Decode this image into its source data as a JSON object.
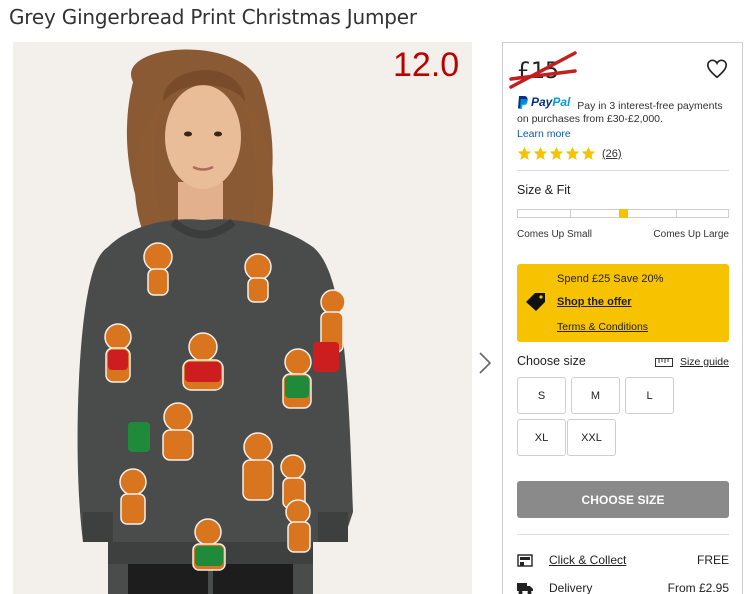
{
  "product": {
    "title": "Grey Gingerbread Print Christmas Jumper",
    "image_overlay_price": "12.0",
    "old_price": "£15"
  },
  "paypal": {
    "brand_part1": "Pay",
    "brand_part2": "Pal",
    "text": "Pay in 3 interest-free payments on purchases from £30-£2,000.",
    "learn_more": "Learn more"
  },
  "rating": {
    "stars": 5,
    "review_count": "(26)"
  },
  "size_fit": {
    "title": "Size & Fit",
    "low_label": "Comes Up Small",
    "high_label": "Comes Up Large",
    "fit_fraction": 0.5
  },
  "promo": {
    "title": "Spend £25 Save 20%",
    "link": "Shop the offer",
    "terms": "Terms & Conditions"
  },
  "size_picker": {
    "title": "Choose size",
    "guide": "Size guide",
    "sizes": [
      "S",
      "M",
      "L",
      "XL",
      "XXL"
    ]
  },
  "cta": {
    "label": "CHOOSE SIZE"
  },
  "delivery": [
    {
      "label": "Click & Collect",
      "price": "FREE",
      "icon": "store-icon"
    },
    {
      "label": "Delivery",
      "price": "From £2.95",
      "icon": "truck-icon"
    }
  ],
  "colors": {
    "overlay_price": "#bb0000",
    "strike": "#c41e1e",
    "promo_bg": "#f7c300",
    "fit_marker": "#f5c400",
    "cta_bg": "#8a8a8a",
    "paypal_blue": "#003087",
    "paypal_light": "#009cde",
    "star": "#f5c400"
  }
}
